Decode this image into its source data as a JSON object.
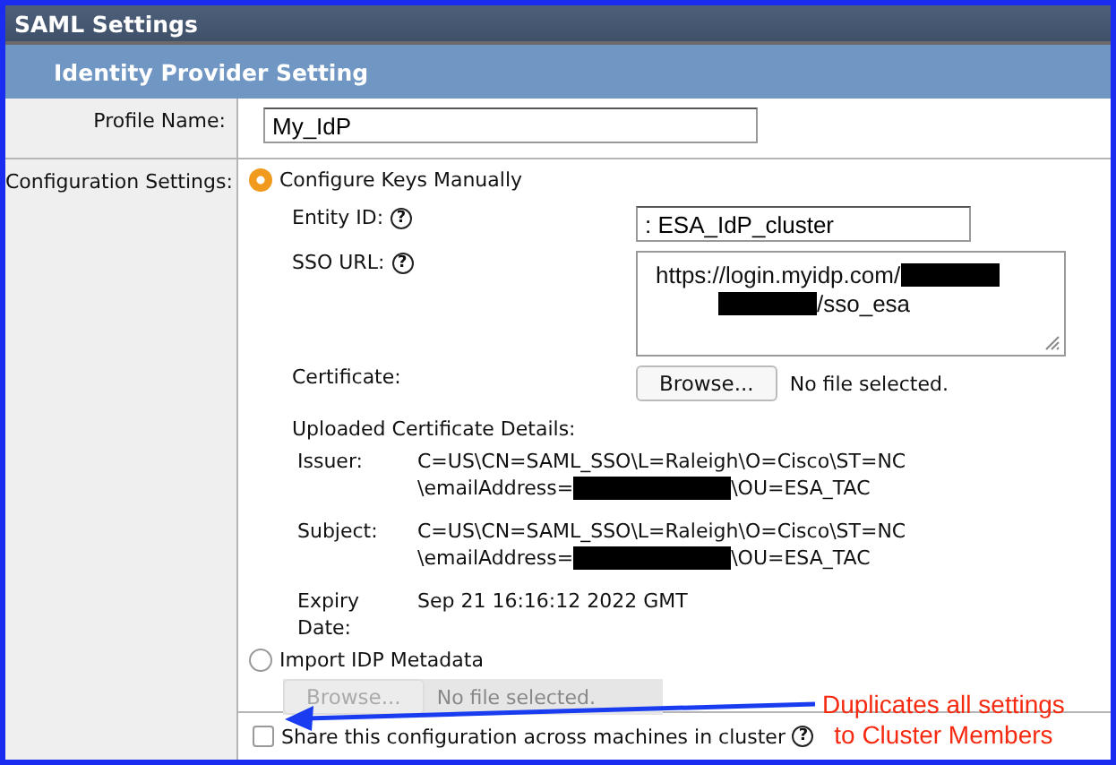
{
  "window": {
    "title": "SAML Settings"
  },
  "section": {
    "title": "Identity Provider Setting"
  },
  "profile": {
    "label": "Profile Name:",
    "value": "My_IdP"
  },
  "configuration": {
    "label": "Configuration Settings:",
    "options": [
      {
        "kind": "manual",
        "label": "Configure Keys Manually",
        "selected": true
      },
      {
        "kind": "metadata",
        "label": "Import IDP Metadata",
        "selected": false
      }
    ],
    "entity_id": {
      "label": "Entity ID:",
      "help": "?",
      "value": ": ESA_IdP_cluster"
    },
    "sso_url": {
      "label": "SSO URL:",
      "help": "?",
      "lines": [
        [
          {
            "kind": "text",
            "text": "https://login.myidp.com/"
          },
          {
            "kind": "redacted"
          }
        ],
        [
          {
            "kind": "redacted"
          },
          {
            "kind": "text",
            "text": "/sso_esa"
          }
        ]
      ]
    },
    "certificate": {
      "label": "Certificate:",
      "button": "Browse...",
      "file_status": "No file selected."
    },
    "details": {
      "title": "Uploaded Certificate Details:",
      "fields": [
        {
          "label": "Issuer:",
          "lines": [
            [
              {
                "kind": "text",
                "text": "C=US\\CN=SAML_SSO\\L=Raleigh\\O=Cisco\\ST=NC"
              }
            ],
            [
              {
                "kind": "text",
                "text": "\\emailAddress="
              },
              {
                "kind": "redacted"
              },
              {
                "kind": "text",
                "text": "\\OU=ESA_TAC"
              }
            ]
          ]
        },
        {
          "label": "Subject:",
          "lines": [
            [
              {
                "kind": "text",
                "text": "C=US\\CN=SAML_SSO\\L=Raleigh\\O=Cisco\\ST=NC"
              }
            ],
            [
              {
                "kind": "text",
                "text": "\\emailAddress="
              },
              {
                "kind": "redacted"
              },
              {
                "kind": "text",
                "text": "\\OU=ESA_TAC"
              }
            ]
          ]
        },
        {
          "label": "Expiry Date:",
          "lines": [
            [
              {
                "kind": "text",
                "text": "Sep 21 16:16:12 2022 GMT"
              }
            ]
          ]
        }
      ]
    },
    "metadata_file": {
      "button": "Browse...",
      "file_status": "No file selected.",
      "disabled": true
    }
  },
  "share": {
    "label": "Share this configuration across machines in cluster",
    "help": "?",
    "checked": false
  },
  "annotation": {
    "lines": [
      "Duplicates all settings",
      "to Cluster Members"
    ]
  }
}
